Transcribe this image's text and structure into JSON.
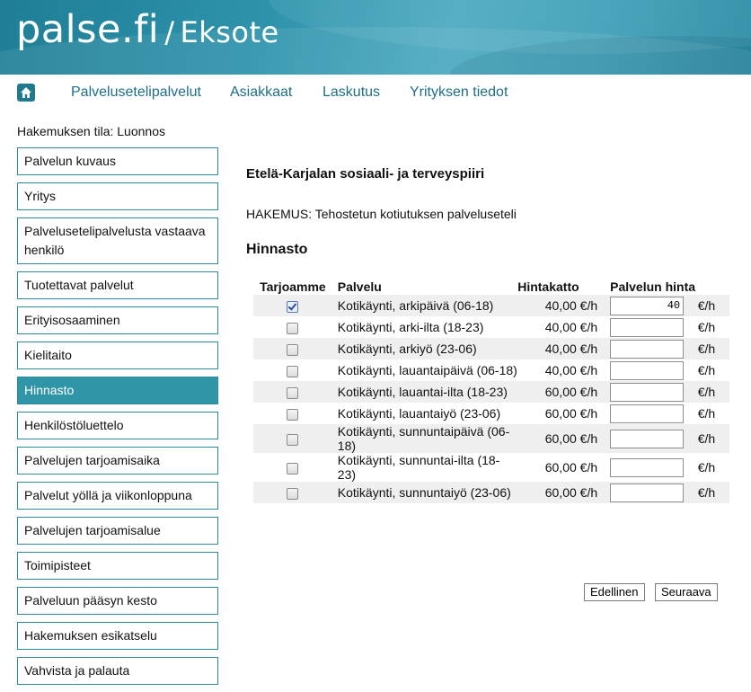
{
  "brand": {
    "logo": "palse.fi",
    "separator": "/",
    "org": "Eksote"
  },
  "nav": {
    "home_icon": "home-icon",
    "items": [
      "Palvelusetelipalvelut",
      "Asiakkaat",
      "Laskutus",
      "Yrityksen tiedot"
    ]
  },
  "status": "Hakemuksen tila: Luonnos",
  "sidebar": {
    "items": [
      {
        "label": "Palvelun kuvaus"
      },
      {
        "label": "Yritys"
      },
      {
        "label": "Palvelusetelipalvelusta vastaava henkilö"
      },
      {
        "label": "Tuotettavat palvelut"
      },
      {
        "label": "Erityisosaaminen"
      },
      {
        "label": "Kielitaito"
      },
      {
        "label": "Hinnasto",
        "active": true
      },
      {
        "label": "Henkilöstöluettelo"
      },
      {
        "label": "Palvelujen tarjoamisaika"
      },
      {
        "label": "Palvelut yöllä ja viikonloppuna"
      },
      {
        "label": "Palvelujen tarjoamisalue"
      },
      {
        "label": "Toimipisteet"
      },
      {
        "label": "Palveluun pääsyn kesto"
      },
      {
        "label": "Hakemuksen esikatselu"
      },
      {
        "label": "Vahvista ja palauta"
      }
    ]
  },
  "main": {
    "org_title": "Etelä-Karjalan sosiaali- ja terveyspiiri",
    "application": "HAKEMUS: Tehostetun kotiutuksen palveluseteli",
    "section_title": "Hinnasto"
  },
  "table": {
    "headers": {
      "offer": "Tarjoamme",
      "service": "Palvelu",
      "cap": "Hintakatto",
      "price": "Palvelun hinta"
    },
    "unit": "€/h",
    "rows": [
      {
        "checked": true,
        "service": "Kotikäynti, arkipäivä (06-18)",
        "cap": "40,00  €/h",
        "price": "40"
      },
      {
        "checked": false,
        "service": "Kotikäynti, arki-ilta (18-23)",
        "cap": "40,00  €/h",
        "price": ""
      },
      {
        "checked": false,
        "service": "Kotikäynti, arkiyö (23-06)",
        "cap": "40,00  €/h",
        "price": ""
      },
      {
        "checked": false,
        "service": "Kotikäynti, lauantaipäivä (06-18)",
        "cap": "40,00  €/h",
        "price": ""
      },
      {
        "checked": false,
        "service": "Kotikäynti, lauantai-ilta (18-23)",
        "cap": "60,00  €/h",
        "price": ""
      },
      {
        "checked": false,
        "service": "Kotikäynti, lauantaiyö (23-06)",
        "cap": "60,00  €/h",
        "price": ""
      },
      {
        "checked": false,
        "service": "Kotikäynti, sunnuntaipäivä (06-18)",
        "cap": "60,00  €/h",
        "price": ""
      },
      {
        "checked": false,
        "service": "Kotikäynti, sunnuntai-ilta (18-23)",
        "cap": "60,00  €/h",
        "price": ""
      },
      {
        "checked": false,
        "service": "Kotikäynti, sunnuntaiyö (23-06)",
        "cap": "60,00  €/h",
        "price": ""
      }
    ]
  },
  "buttons": {
    "prev": "Edellinen",
    "next": "Seuraava"
  }
}
